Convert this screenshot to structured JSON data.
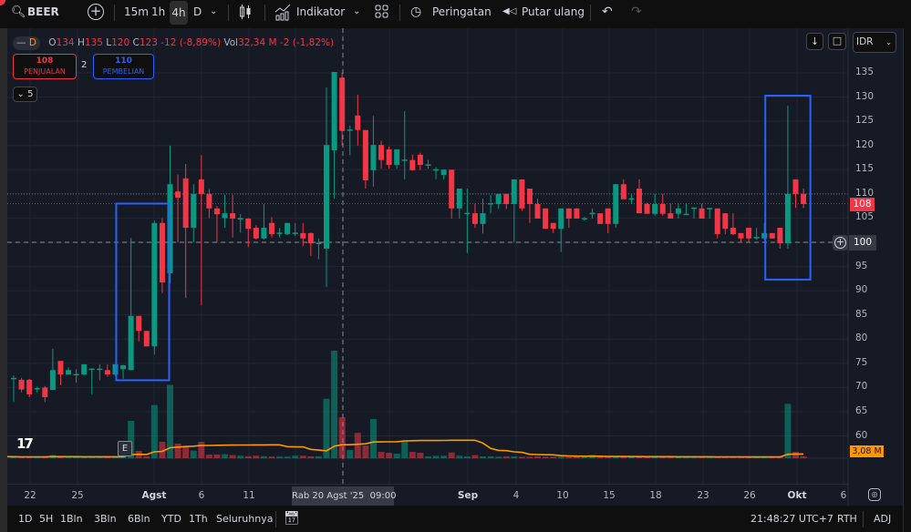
{
  "toolbar": {
    "symbol": "BEER",
    "intervals": [
      "15m",
      "1h",
      "4h",
      "D"
    ],
    "active_interval": "4h",
    "indicators_label": "Indikator",
    "alerts_label": "Peringatan",
    "replay_label": "Putar ulang"
  },
  "legend": {
    "interval": "D",
    "o_label": "O",
    "o": "134",
    "h_label": "H",
    "h": "135",
    "l_label": "L",
    "l": "120",
    "c_label": "C",
    "c": "123",
    "change": "-12 (-8,89%)",
    "vol_label": "Vol",
    "vol": "32,34 M",
    "vol_change": "-2 (-1,82%)",
    "collapse_count": "5"
  },
  "trade": {
    "sell_price": "108",
    "sell_label": "PENJUALAN",
    "spread": "2",
    "buy_price": "110",
    "buy_label": "PEMBELIAN"
  },
  "currency": "IDR",
  "price_tags": {
    "last": "108",
    "crosshair": "100",
    "volume_ma": "3,08 M"
  },
  "time_axis": {
    "labels": [
      "22",
      "25",
      "Agst",
      "6",
      "11",
      "Sep",
      "4",
      "10",
      "15",
      "18",
      "23",
      "26",
      "Okt",
      "6"
    ],
    "crosshair": "Rab 20 Agst '25  09:00"
  },
  "bottom": {
    "ranges": [
      "1D",
      "5H",
      "1Bln",
      "3Bln",
      "6Bln",
      "YTD",
      "1Th",
      "Seluruhnya"
    ],
    "clock": "21:48:27 UTC+7",
    "session": "RTH",
    "adj": "ADJ"
  },
  "event_marker": "E",
  "colors": {
    "up": "#089981",
    "down": "#f23645",
    "accent": "#2962ff",
    "vol_ma": "#ff9800",
    "bg": "#161a25"
  },
  "chart_data": {
    "type": "candlestick",
    "symbol": "BEER",
    "price_ticks": [
      135,
      130,
      125,
      120,
      115,
      110,
      105,
      100,
      95,
      90,
      85,
      80,
      75,
      70,
      65,
      60
    ],
    "ylim": [
      57.5,
      140
    ],
    "crosshair_price": 100,
    "sell_line": 108,
    "buy_line": 110,
    "ohlc": [
      [
        72,
        72.5,
        67,
        72
      ],
      [
        71.6,
        72,
        69,
        69.6
      ],
      [
        71.6,
        71.8,
        68,
        68.6
      ],
      [
        69.8,
        70.2,
        69,
        69.9
      ],
      [
        70,
        70.3,
        67,
        68
      ],
      [
        69.5,
        78,
        69.5,
        73.6
      ],
      [
        75.5,
        75.5,
        70.5,
        72.7
      ],
      [
        72.7,
        74.2,
        72.7,
        73.6
      ],
      [
        72.7,
        73.8,
        71,
        72.8
      ],
      [
        72.7,
        74.8,
        72.5,
        74.8
      ],
      [
        73.8,
        74,
        68.6,
        73.9
      ],
      [
        73.8,
        74.8,
        71.5,
        73.9
      ],
      [
        73.6,
        74.8,
        72.2,
        72.7
      ],
      [
        72.7,
        74.8,
        72.5,
        74.8
      ],
      [
        73.8,
        74.7,
        71.8,
        74.6
      ],
      [
        73.6,
        100.9,
        73.6,
        84.8
      ],
      [
        84.8,
        84.8,
        79.5,
        81.7
      ],
      [
        81.7,
        81.7,
        78.5,
        78.5
      ],
      [
        78.5,
        104.5,
        76.8,
        104
      ],
      [
        104,
        105,
        89.5,
        91.7
      ],
      [
        93.6,
        120,
        91.5,
        112
      ],
      [
        110.5,
        114,
        100,
        109.2
      ],
      [
        113.2,
        116.2,
        88.5,
        103
      ],
      [
        103,
        112,
        100,
        110
      ],
      [
        113,
        118,
        87,
        110
      ],
      [
        110,
        111,
        105,
        107
      ],
      [
        107,
        107.5,
        100,
        105.8
      ],
      [
        105,
        109.8,
        103,
        106
      ],
      [
        106,
        109.8,
        101,
        104.9
      ],
      [
        104.9,
        105.8,
        102,
        105
      ],
      [
        104.9,
        105,
        99,
        102.8
      ],
      [
        103,
        103.5,
        100.6,
        100.8
      ],
      [
        100.8,
        107.9,
        100.6,
        103
      ],
      [
        104,
        105.2,
        101,
        101.7
      ],
      [
        101.9,
        103,
        101,
        102
      ],
      [
        101.7,
        104,
        101.5,
        104
      ],
      [
        101.9,
        104,
        101.3,
        102
      ],
      [
        101.9,
        104,
        99.2,
        100.8
      ],
      [
        101.9,
        102,
        97.2,
        99.8
      ],
      [
        99.8,
        100.8,
        96.5,
        99.9
      ],
      [
        98.7,
        132,
        90.8,
        120.1
      ],
      [
        119,
        135.2,
        109,
        135.2
      ],
      [
        134,
        135,
        120,
        123
      ],
      [
        123.2,
        124.1,
        118,
        123.3
      ],
      [
        126.2,
        130.5,
        120,
        123.2
      ],
      [
        123.2,
        123.2,
        111.1,
        112.8
      ],
      [
        114.9,
        126.1,
        111.5,
        120.1
      ],
      [
        120.1,
        121,
        115.2,
        117
      ],
      [
        119.2,
        119.8,
        115.2,
        116
      ],
      [
        116,
        119.2,
        115.2,
        119.2
      ],
      [
        117,
        127.1,
        113,
        117.1
      ],
      [
        117,
        118.1,
        114.9,
        114.9
      ],
      [
        118.1,
        118.5,
        114.9,
        116
      ],
      [
        116,
        117,
        115.2,
        116.1
      ],
      [
        115,
        115.5,
        113,
        115.1
      ],
      [
        113.9,
        115,
        113,
        115
      ],
      [
        115,
        115,
        104.9,
        107
      ],
      [
        107,
        111.1,
        104.9,
        111.1
      ],
      [
        106,
        111.1,
        97.8,
        106.1
      ],
      [
        106,
        108,
        103,
        103.8
      ],
      [
        103.8,
        109,
        101.8,
        106
      ],
      [
        108,
        109.8,
        106,
        108.1
      ],
      [
        107.9,
        110,
        106.9,
        110
      ],
      [
        110,
        110,
        106.9,
        107.9
      ],
      [
        107.9,
        113,
        100,
        113
      ],
      [
        113,
        113,
        106.5,
        107
      ],
      [
        111.1,
        111.1,
        104,
        107.9
      ],
      [
        107.9,
        109,
        104.9,
        104.9
      ],
      [
        107,
        107,
        102.8,
        102.8
      ],
      [
        104,
        104,
        101.9,
        102.8
      ],
      [
        102.8,
        107,
        98,
        107
      ],
      [
        107,
        107,
        103,
        104.9
      ],
      [
        107,
        107,
        104.9,
        104.9
      ],
      [
        104.9,
        105.3,
        104.5,
        105
      ],
      [
        106,
        107,
        104.9,
        106.1
      ],
      [
        106,
        106,
        103.8,
        103.8
      ],
      [
        107,
        107,
        101.9,
        103.8
      ],
      [
        103.8,
        112,
        103,
        112
      ],
      [
        112,
        113,
        108.9,
        108.9
      ],
      [
        109,
        110,
        107.9,
        109.1
      ],
      [
        111.1,
        113,
        106,
        106
      ],
      [
        107.9,
        108.2,
        105.9,
        105.9
      ],
      [
        105.9,
        110,
        105.5,
        107.9
      ],
      [
        107.9,
        110,
        105.5,
        105.9
      ],
      [
        106,
        108,
        104.9,
        104.9
      ],
      [
        105.9,
        108,
        104.9,
        107
      ],
      [
        105.8,
        108,
        105.8,
        105.9
      ],
      [
        107.1,
        107.1,
        104.9,
        107.2
      ],
      [
        107,
        108,
        104.9,
        104.9
      ],
      [
        107,
        107.1,
        104.9,
        107.1
      ],
      [
        107,
        107,
        100.8,
        101.7
      ],
      [
        106,
        106,
        101.7,
        102.8
      ],
      [
        103,
        106,
        101.5,
        101.7
      ],
      [
        101.9,
        101.9,
        100,
        100.8
      ],
      [
        103,
        103,
        100,
        100.8
      ],
      [
        101,
        103,
        100.5,
        101.1
      ],
      [
        100.8,
        104,
        100.5,
        101.9
      ],
      [
        101.9,
        101.9,
        100.8,
        100.8
      ],
      [
        103,
        103,
        98.7,
        99.8
      ],
      [
        99.8,
        128.2,
        98.7,
        110
      ],
      [
        113,
        113,
        107.1,
        110
      ],
      [
        110,
        111.1,
        107.1,
        107.9
      ]
    ],
    "volume_millions": [
      1.2,
      1,
      1,
      1,
      1,
      2.5,
      1,
      1,
      1,
      1,
      1,
      1,
      1,
      1,
      1.2,
      29.5,
      5.8,
      1.5,
      42,
      13,
      58,
      11.5,
      9.4,
      6,
      13,
      2.9,
      3,
      3.2,
      2.5,
      2,
      1.6,
      2,
      1.6,
      1.3,
      1.3,
      1.3,
      2,
      2,
      1.5,
      1.5,
      47,
      85,
      32.34,
      6.5,
      20,
      10,
      31,
      5,
      4.3,
      3.6,
      14,
      5,
      4.3,
      1.5,
      2,
      2,
      4.5,
      2,
      1.5,
      2.5,
      1.5,
      1.5,
      1.2,
      1.5,
      1.5,
      1.2,
      1.2,
      1.5,
      1.2,
      1.2,
      1.2,
      1,
      1.2,
      1,
      2.5,
      1,
      1.2,
      1.2,
      1,
      1,
      1,
      1,
      1.2,
      1,
      1,
      1,
      1,
      1,
      1,
      1,
      1,
      1,
      1,
      1,
      1,
      1,
      1,
      1,
      1,
      43,
      5,
      1.5
    ],
    "volume_ma_period": 20,
    "highlight_boxes": [
      {
        "from_index": 13,
        "to_index": 20,
        "price_top": 108,
        "price_bottom": 71.5
      },
      {
        "from_index": 96,
        "to_index": 102,
        "price_top": 130.3,
        "price_bottom": 92.3
      }
    ]
  }
}
